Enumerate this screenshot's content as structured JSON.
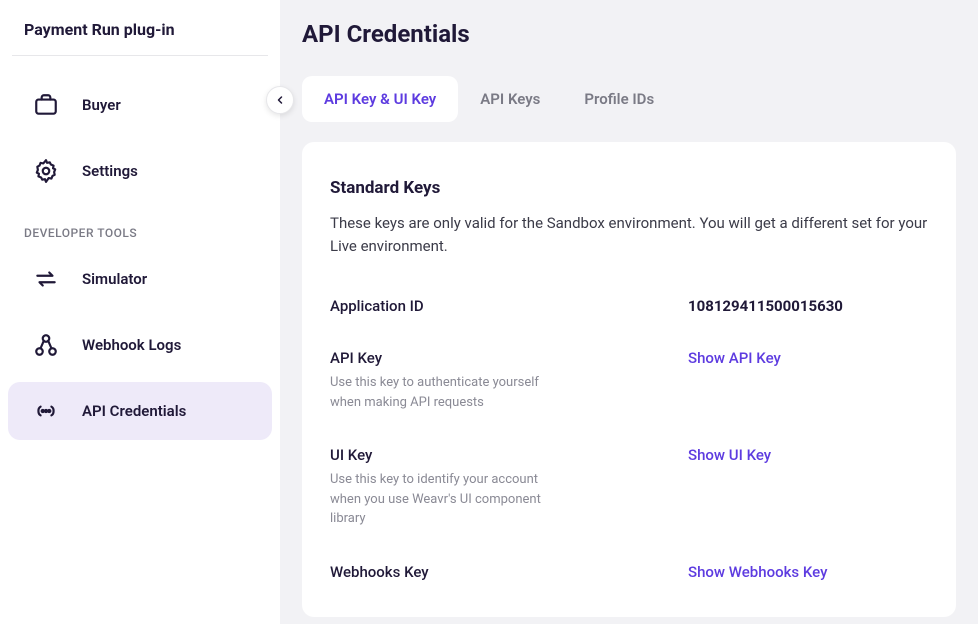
{
  "sidebar": {
    "title": "Payment Run plug-in",
    "section_header": "DEVELOPER TOOLS",
    "nav": [
      {
        "label": "Buyer",
        "icon": "briefcase-icon"
      },
      {
        "label": "Settings",
        "icon": "gear-icon"
      }
    ],
    "dev_nav": [
      {
        "label": "Simulator",
        "icon": "swap-icon"
      },
      {
        "label": "Webhook Logs",
        "icon": "webhook-icon"
      },
      {
        "label": "API Credentials",
        "icon": "api-icon",
        "active": true
      }
    ]
  },
  "page": {
    "title": "API Credentials",
    "tabs": [
      {
        "label": "API Key & UI Key",
        "active": true
      },
      {
        "label": "API Keys"
      },
      {
        "label": "Profile IDs"
      }
    ],
    "card": {
      "title": "Standard Keys",
      "description": "These keys are only valid for the Sandbox environment. You will get a different set for your Live environment.",
      "rows": [
        {
          "label": "Application ID",
          "value": "108129411500015630"
        },
        {
          "label": "API Key",
          "sub": "Use this key to authenticate yourself when making API requests",
          "action": "Show API Key"
        },
        {
          "label": "UI Key",
          "sub": "Use this key to identify your account when you use Weavr's UI component library",
          "action": "Show UI Key"
        },
        {
          "label": "Webhooks Key",
          "action": "Show Webhooks Key"
        }
      ]
    }
  }
}
